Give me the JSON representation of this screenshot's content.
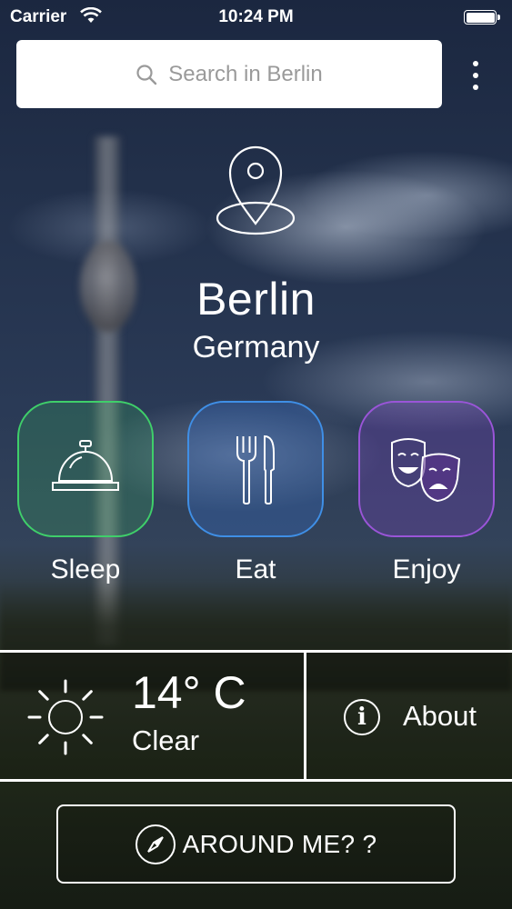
{
  "status_bar": {
    "carrier": "Carrier",
    "time": "10:24 PM"
  },
  "search": {
    "placeholder": "Search in Berlin"
  },
  "location": {
    "city": "Berlin",
    "country": "Germany"
  },
  "categories": [
    {
      "label": "Sleep",
      "color": "#3fcf6a",
      "icon": "bell-icon"
    },
    {
      "label": "Eat",
      "color": "#3f8fe6",
      "icon": "cutlery-icon"
    },
    {
      "label": "Enjoy",
      "color": "#9a55d8",
      "icon": "theater-masks-icon"
    }
  ],
  "weather": {
    "temperature": "14° C",
    "condition": "Clear",
    "icon": "sun-icon"
  },
  "about": {
    "label": "About",
    "icon": "info-icon"
  },
  "around_me": {
    "label": "AROUND ME? ?",
    "icon": "compass-icon"
  }
}
